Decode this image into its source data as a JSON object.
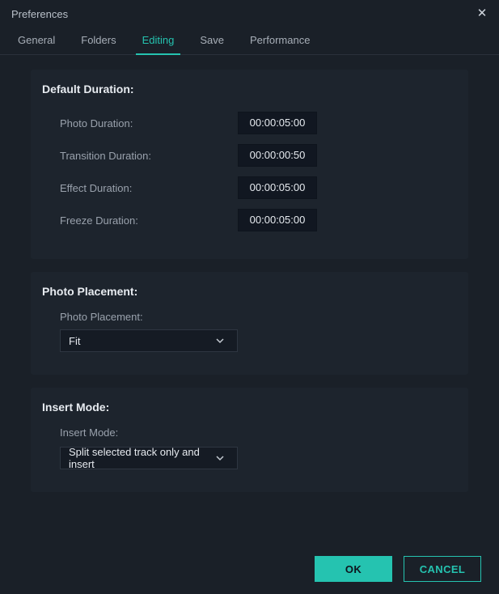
{
  "window": {
    "title": "Preferences"
  },
  "tabs": [
    {
      "label": "General"
    },
    {
      "label": "Folders"
    },
    {
      "label": "Editing"
    },
    {
      "label": "Save"
    },
    {
      "label": "Performance"
    }
  ],
  "sections": {
    "default_duration": {
      "title": "Default Duration:",
      "rows": [
        {
          "label": "Photo Duration:",
          "value": "00:00:05:00"
        },
        {
          "label": "Transition Duration:",
          "value": "00:00:00:50"
        },
        {
          "label": "Effect Duration:",
          "value": "00:00:05:00"
        },
        {
          "label": "Freeze Duration:",
          "value": "00:00:05:00"
        }
      ]
    },
    "photo_placement": {
      "title": "Photo Placement:",
      "label": "Photo Placement:",
      "value": "Fit"
    },
    "insert_mode": {
      "title": "Insert Mode:",
      "label": "Insert Mode:",
      "value": "Split selected track only and insert"
    }
  },
  "footer": {
    "ok": "OK",
    "cancel": "CANCEL"
  }
}
